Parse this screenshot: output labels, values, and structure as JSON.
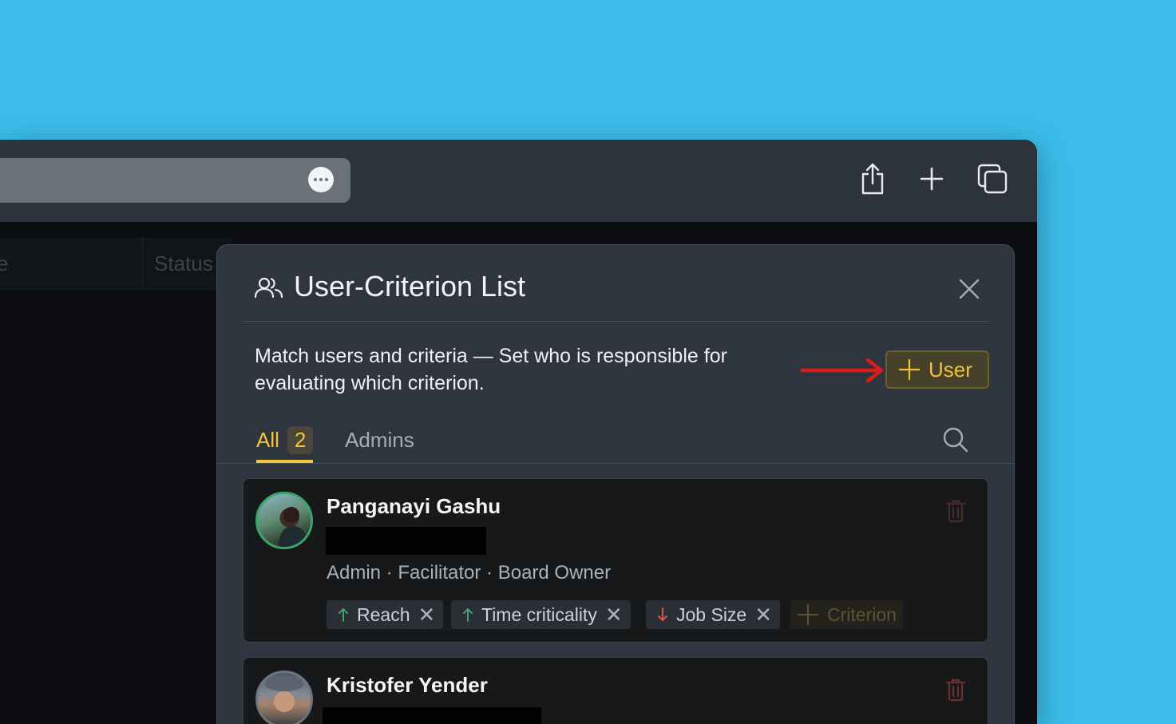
{
  "background_page": {
    "header_partial": "e",
    "status_col": "Status"
  },
  "modal": {
    "title": "User-Criterion List",
    "description": "Match users and criteria — Set who is responsible for evaluating which criterion.",
    "add_user_label": "User",
    "tabs": [
      {
        "label": "All",
        "count": "2",
        "active": true
      },
      {
        "label": "Admins",
        "active": false
      }
    ],
    "users": [
      {
        "name": "Panganayi Gashu",
        "roles": "Admin · Facilitator · Board Owner",
        "criteria": [
          {
            "label": "Reach",
            "direction": "up"
          },
          {
            "label": "Time criticality",
            "direction": "up"
          },
          {
            "label": "Job Size",
            "direction": "down"
          }
        ],
        "add_criterion_label": "Criterion"
      },
      {
        "name": "Kristofer Yender"
      }
    ]
  },
  "colors": {
    "accent": "#f5c33a",
    "up_arrow": "#3fa36b",
    "down_arrow": "#d9534f",
    "annotation_arrow": "#e01b1b"
  }
}
